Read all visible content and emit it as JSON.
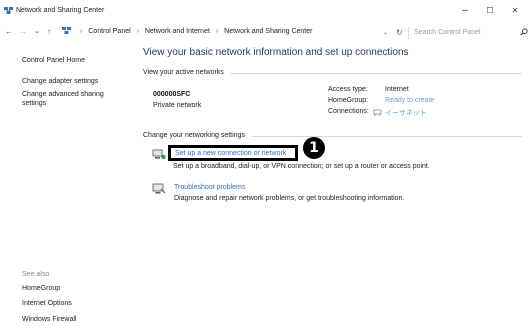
{
  "window": {
    "title": "Network and Sharing Center",
    "controls": {
      "minimize": "–",
      "maximize": "☐",
      "close": "✕"
    }
  },
  "address": {
    "nav": {
      "back": "←",
      "forward": "→",
      "recent": "⌄",
      "up": "↑"
    },
    "crumbs": [
      "Control Panel",
      "Network and Internet",
      "Network and Sharing Center"
    ],
    "separator": "›",
    "dropdown": "⌄",
    "refresh": "↻",
    "search_placeholder": "Search Control Panel"
  },
  "sidebar": {
    "home": "Control Panel Home",
    "items": [
      "Change adapter settings",
      "Change advanced sharing",
      "settings"
    ],
    "see_also_label": "See also",
    "see_also": [
      "HomeGroup",
      "Internet Options",
      "Windows Firewall"
    ]
  },
  "main": {
    "title": "View your basic network information and set up connections",
    "active_networks_label": "View your active networks",
    "network": {
      "name": "000000SFC",
      "type": "Private network",
      "access_type_label": "Access type:",
      "access_type": "Internet",
      "homegroup_label": "HomeGroup:",
      "homegroup": "Ready to create",
      "connections_label": "Connections:",
      "connections": "イーサネット"
    },
    "change_label": "Change your networking settings",
    "tasks": [
      {
        "link": "Set up a new connection or network",
        "desc": "Set up a broadband, dial-up, or VPN connection; or set up a router or access point."
      },
      {
        "link": "Troubleshoot problems",
        "desc": "Diagnose and repair network problems, or get troubleshooting information."
      }
    ],
    "marker": "1"
  },
  "colors": {
    "accent_link": "#2a6fbf",
    "title": "#1e3a6a",
    "highlight_border": "#000000"
  }
}
